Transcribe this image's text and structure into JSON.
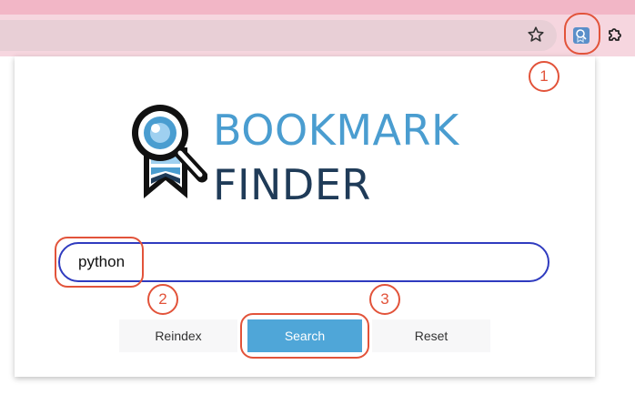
{
  "browser": {
    "star_icon": "star-icon",
    "extension_icon": "bookmark-finder-extension-icon",
    "extensions_icon": "puzzle-icon"
  },
  "logo": {
    "line1": "BOOKMARK",
    "line2": "FINDER",
    "colors": {
      "line1": "#4a9dd0",
      "line2": "#1f3b58"
    }
  },
  "search": {
    "value": "python"
  },
  "buttons": {
    "reindex": "Reindex",
    "search": "Search",
    "reset": "Reset"
  },
  "annotations": {
    "badge1": "1",
    "badge2": "2",
    "badge3": "3",
    "color": "#e2533a"
  },
  "colors": {
    "accent": "#4fa6d8",
    "input_border": "#2f3bbf",
    "toolbar": "#f6d6df"
  }
}
